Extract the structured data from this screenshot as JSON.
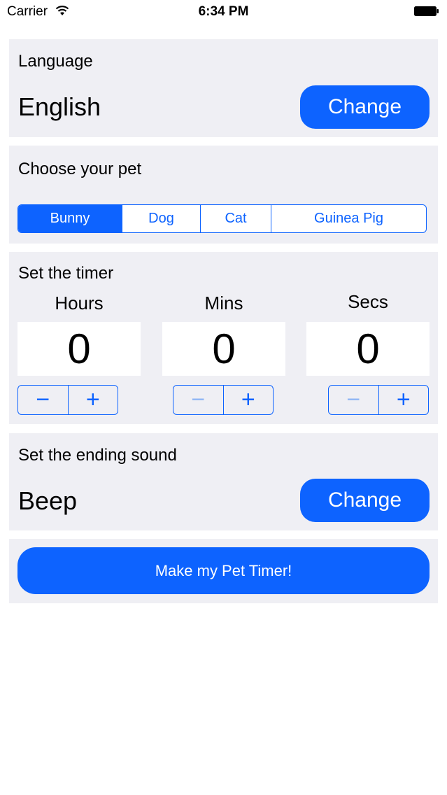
{
  "status_bar": {
    "carrier": "Carrier",
    "time": "6:34 PM"
  },
  "language": {
    "title": "Language",
    "value": "English",
    "change_label": "Change"
  },
  "pet": {
    "title": "Choose your pet",
    "options": [
      "Bunny",
      "Dog",
      "Cat",
      "Guinea Pig"
    ],
    "selected": "Bunny"
  },
  "timer": {
    "title": "Set the timer",
    "hours": {
      "label": "Hours",
      "value": "0"
    },
    "mins": {
      "label": "Mins",
      "value": "0"
    },
    "secs": {
      "label": "Secs",
      "value": "0"
    },
    "minus_label": "−",
    "plus_label": "+"
  },
  "sound": {
    "title": "Set the ending sound",
    "value": "Beep",
    "change_label": "Change"
  },
  "make_button": {
    "label": "Make my Pet Timer!"
  },
  "colors": {
    "accent": "#0d63ff",
    "panel": "#efeff4",
    "disabled": "#8fb6f5"
  }
}
